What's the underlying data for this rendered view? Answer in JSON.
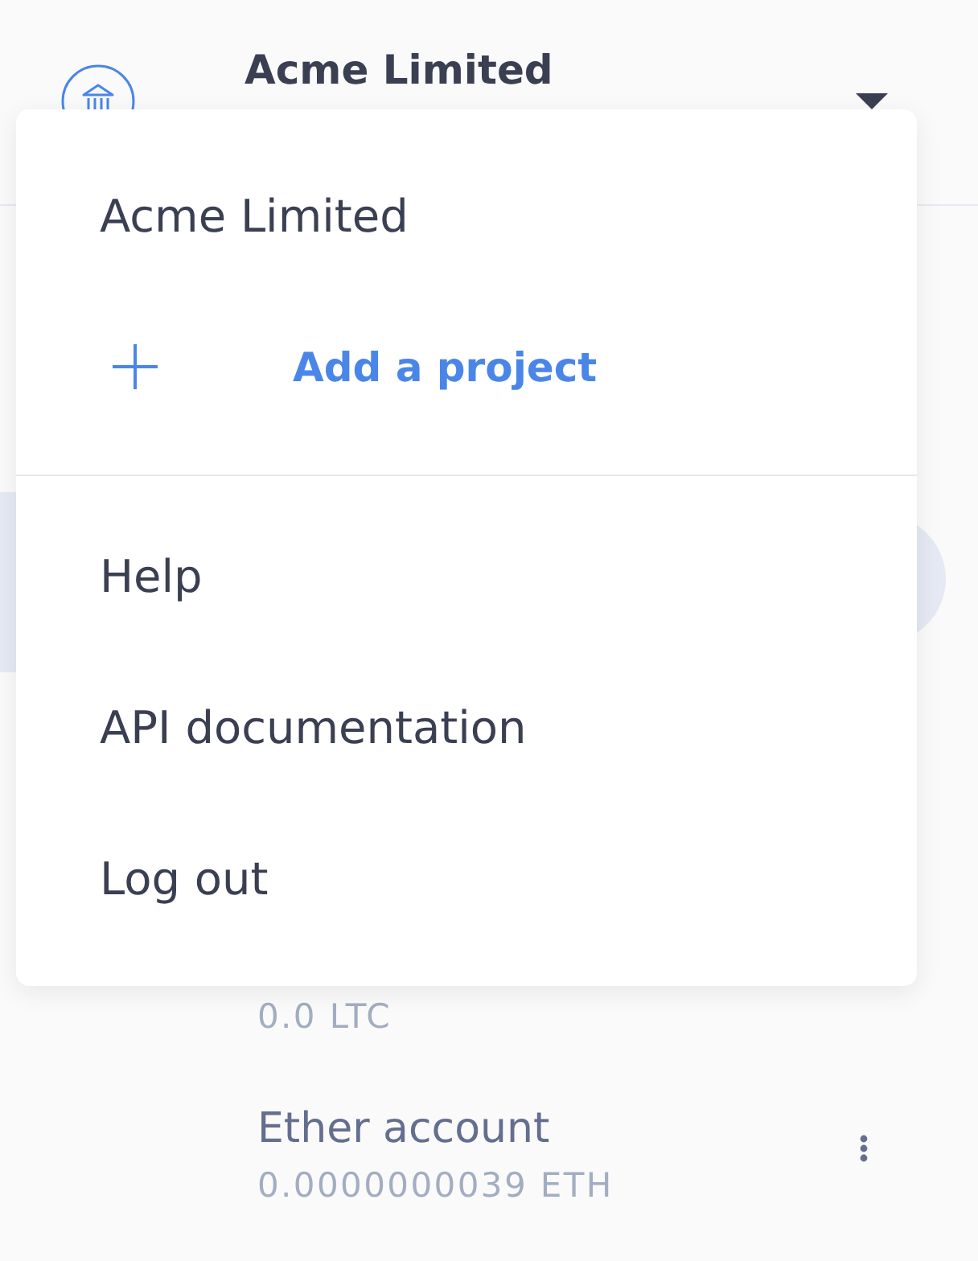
{
  "header": {
    "title": "Acme Limited"
  },
  "accounts": [
    {
      "selected": true
    },
    {
      "balance": "0.0 LTC",
      "selected": false
    },
    {
      "name": "Ether account",
      "balance": "0.0000000039 ETH",
      "selected": false
    }
  ],
  "menu": {
    "sections": [
      {
        "items": [
          {
            "kind": "item",
            "label": "Acme Limited"
          },
          {
            "kind": "add",
            "label": "Add a project"
          }
        ]
      },
      {
        "items": [
          {
            "kind": "item",
            "label": "Help"
          },
          {
            "kind": "item",
            "label": "API documentation"
          },
          {
            "kind": "item",
            "label": "Log out"
          }
        ]
      }
    ]
  }
}
